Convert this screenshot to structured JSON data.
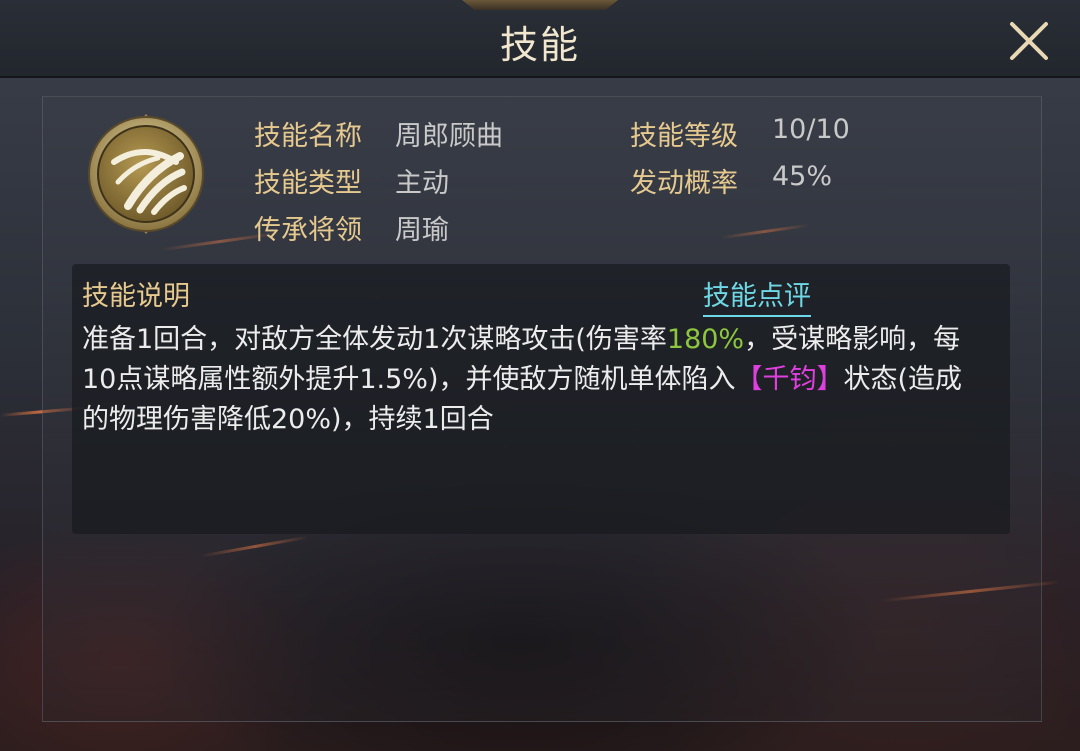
{
  "header": {
    "title": "技能"
  },
  "skill": {
    "name_label": "技能名称",
    "name_value": "周郎顾曲",
    "type_label": "技能类型",
    "type_value": "主动",
    "general_label": "传承将领",
    "general_value": "周瑜",
    "level_label": "技能等级",
    "level_value": "10/10",
    "rate_label": "发动概率",
    "rate_value": "45%"
  },
  "description": {
    "title": "技能说明",
    "review_link": "技能点评",
    "text_1": "准备1回合，对敌方全体发动1次谋略攻击(伤害率",
    "text_highlight_green": "180%",
    "text_2": "，受谋略影响，每10点谋略属性额外提升1.5%)，并使敌方随机单体陷入",
    "text_highlight_magenta": "【千钧】",
    "text_3": "状态(造成的物理伤害降低20%)，持续1回合"
  },
  "colors": {
    "label_gold": "#e6c98f",
    "value_gray": "#c9c9c9",
    "highlight_green": "#8dc63f",
    "highlight_magenta": "#e03fe0",
    "link_cyan": "#6fd8e6"
  },
  "icons": {
    "close": "close-x-icon",
    "skill": "wind-swirl-skill-icon"
  }
}
